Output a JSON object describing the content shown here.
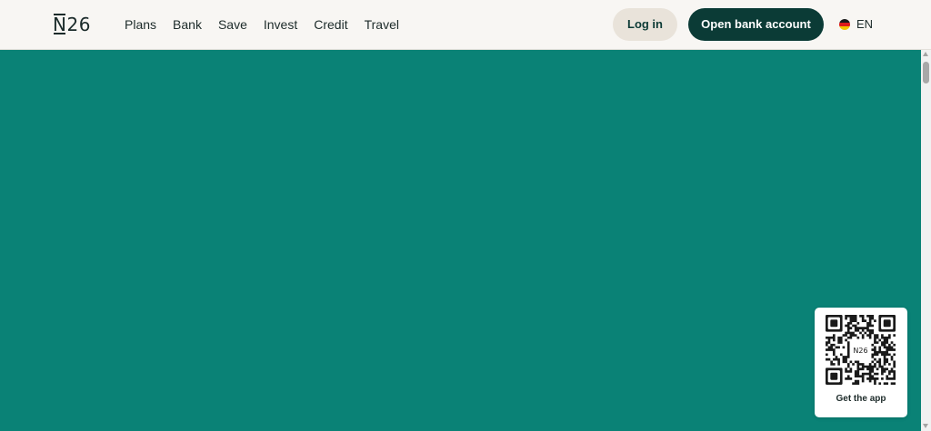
{
  "header": {
    "logo_text": "N26",
    "nav": [
      {
        "label": "Plans"
      },
      {
        "label": "Bank"
      },
      {
        "label": "Save"
      },
      {
        "label": "Invest"
      },
      {
        "label": "Credit"
      },
      {
        "label": "Travel"
      }
    ],
    "login_label": "Log in",
    "open_account_label": "Open bank account",
    "language": {
      "flag_icon": "germany-flag-icon",
      "label": "EN"
    }
  },
  "hero": {
    "background_color": "#0a8276"
  },
  "app_promo": {
    "qr_center_text": "N26",
    "caption": "Get the app"
  },
  "colors": {
    "header_bg": "#f8f6f3",
    "login_bg": "#e9e3da",
    "primary_button_bg": "#0b3b36",
    "hero_bg": "#0a8276"
  }
}
